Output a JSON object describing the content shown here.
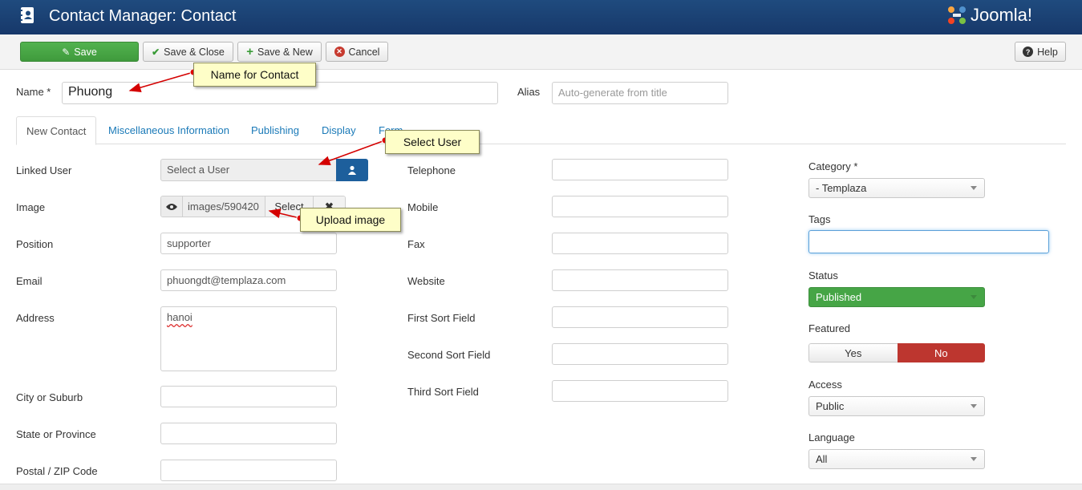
{
  "header": {
    "title": "Contact Manager: Contact",
    "logo_text": "Joomla!"
  },
  "toolbar": {
    "save": "Save",
    "save_close": "Save & Close",
    "save_new": "Save & New",
    "cancel": "Cancel",
    "help": "Help"
  },
  "name_field": {
    "label": "Name *",
    "value": "Phuong"
  },
  "alias_field": {
    "label": "Alias",
    "placeholder": "Auto-generate from title"
  },
  "tabs": [
    "New Contact",
    "Miscellaneous Information",
    "Publishing",
    "Display",
    "Form"
  ],
  "left": {
    "linked_user": {
      "label": "Linked User",
      "value": "Select a User"
    },
    "image": {
      "label": "Image",
      "path": "images/590420",
      "select": "Select"
    },
    "position": {
      "label": "Position",
      "value": "supporter"
    },
    "email": {
      "label": "Email",
      "value": "phuongdt@templaza.com"
    },
    "address": {
      "label": "Address",
      "value": "hanoi"
    },
    "city": {
      "label": "City or Suburb",
      "value": ""
    },
    "state": {
      "label": "State or Province",
      "value": ""
    },
    "postal": {
      "label": "Postal / ZIP Code",
      "value": ""
    }
  },
  "middle": {
    "telephone": "Telephone",
    "mobile": "Mobile",
    "fax": "Fax",
    "website": "Website",
    "first_sort": "First Sort Field",
    "second_sort": "Second Sort Field",
    "third_sort": "Third Sort Field"
  },
  "right": {
    "category": {
      "label": "Category *",
      "value": "- Templaza"
    },
    "tags": {
      "label": "Tags",
      "value": ""
    },
    "status": {
      "label": "Status",
      "value": "Published",
      "color": "#46a546"
    },
    "featured": {
      "label": "Featured",
      "yes": "Yes",
      "no": "No",
      "selected": "No",
      "color": "#bd362f"
    },
    "access": {
      "label": "Access",
      "value": "Public"
    },
    "language": {
      "label": "Language",
      "value": "All"
    }
  },
  "callouts": {
    "name": "Name for Contact",
    "user": "Select User",
    "image": "Upload image"
  }
}
